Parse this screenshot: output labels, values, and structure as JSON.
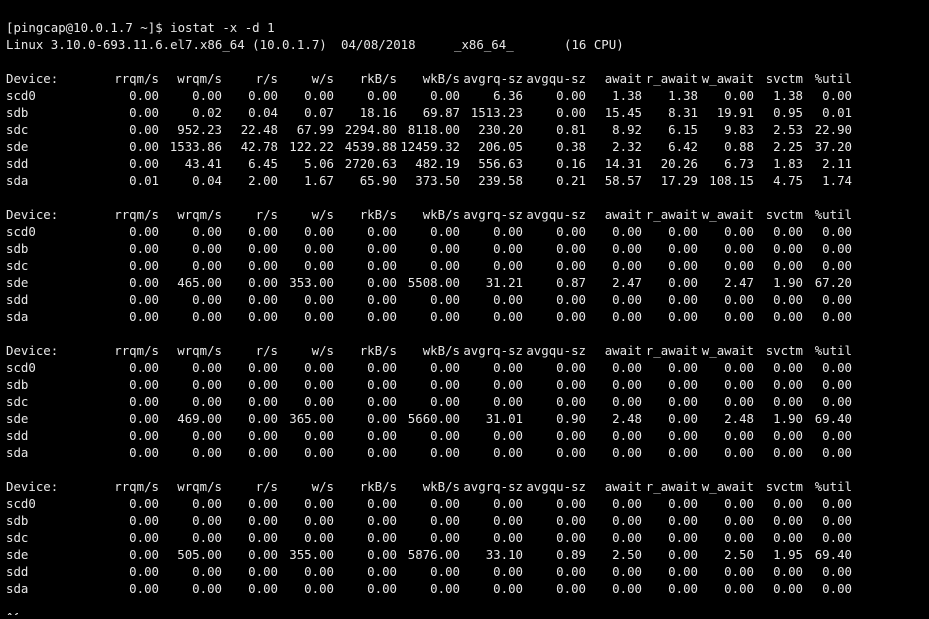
{
  "prompt": "[pingcap@10.0.1.7 ~]$ iostat -x -d 1",
  "system_info": {
    "kernel": "Linux 3.10.0-693.11.6.el7.x86_64 (10.0.1.7)",
    "date": "04/08/2018",
    "arch": "_x86_64_",
    "cpus": "(16 CPU)"
  },
  "columns": [
    "Device:",
    "rrqm/s",
    "wrqm/s",
    "r/s",
    "w/s",
    "rkB/s",
    "wkB/s",
    "avgrq-sz",
    "avgqu-sz",
    "await",
    "r_await",
    "w_await",
    "svctm",
    "%util"
  ],
  "reports": [
    {
      "rows": [
        [
          "scd0",
          "0.00",
          "0.00",
          "0.00",
          "0.00",
          "0.00",
          "0.00",
          "6.36",
          "0.00",
          "1.38",
          "1.38",
          "0.00",
          "1.38",
          "0.00"
        ],
        [
          "sdb",
          "0.00",
          "0.02",
          "0.04",
          "0.07",
          "18.16",
          "69.87",
          "1513.23",
          "0.00",
          "15.45",
          "8.31",
          "19.91",
          "0.95",
          "0.01"
        ],
        [
          "sdc",
          "0.00",
          "952.23",
          "22.48",
          "67.99",
          "2294.80",
          "8118.00",
          "230.20",
          "0.81",
          "8.92",
          "6.15",
          "9.83",
          "2.53",
          "22.90"
        ],
        [
          "sde",
          "0.00",
          "1533.86",
          "42.78",
          "122.22",
          "4539.88",
          "12459.32",
          "206.05",
          "0.38",
          "2.32",
          "6.42",
          "0.88",
          "2.25",
          "37.20"
        ],
        [
          "sdd",
          "0.00",
          "43.41",
          "6.45",
          "5.06",
          "2720.63",
          "482.19",
          "556.63",
          "0.16",
          "14.31",
          "20.26",
          "6.73",
          "1.83",
          "2.11"
        ],
        [
          "sda",
          "0.01",
          "0.04",
          "2.00",
          "1.67",
          "65.90",
          "373.50",
          "239.58",
          "0.21",
          "58.57",
          "17.29",
          "108.15",
          "4.75",
          "1.74"
        ]
      ]
    },
    {
      "rows": [
        [
          "scd0",
          "0.00",
          "0.00",
          "0.00",
          "0.00",
          "0.00",
          "0.00",
          "0.00",
          "0.00",
          "0.00",
          "0.00",
          "0.00",
          "0.00",
          "0.00"
        ],
        [
          "sdb",
          "0.00",
          "0.00",
          "0.00",
          "0.00",
          "0.00",
          "0.00",
          "0.00",
          "0.00",
          "0.00",
          "0.00",
          "0.00",
          "0.00",
          "0.00"
        ],
        [
          "sdc",
          "0.00",
          "0.00",
          "0.00",
          "0.00",
          "0.00",
          "0.00",
          "0.00",
          "0.00",
          "0.00",
          "0.00",
          "0.00",
          "0.00",
          "0.00"
        ],
        [
          "sde",
          "0.00",
          "465.00",
          "0.00",
          "353.00",
          "0.00",
          "5508.00",
          "31.21",
          "0.87",
          "2.47",
          "0.00",
          "2.47",
          "1.90",
          "67.20"
        ],
        [
          "sdd",
          "0.00",
          "0.00",
          "0.00",
          "0.00",
          "0.00",
          "0.00",
          "0.00",
          "0.00",
          "0.00",
          "0.00",
          "0.00",
          "0.00",
          "0.00"
        ],
        [
          "sda",
          "0.00",
          "0.00",
          "0.00",
          "0.00",
          "0.00",
          "0.00",
          "0.00",
          "0.00",
          "0.00",
          "0.00",
          "0.00",
          "0.00",
          "0.00"
        ]
      ]
    },
    {
      "rows": [
        [
          "scd0",
          "0.00",
          "0.00",
          "0.00",
          "0.00",
          "0.00",
          "0.00",
          "0.00",
          "0.00",
          "0.00",
          "0.00",
          "0.00",
          "0.00",
          "0.00"
        ],
        [
          "sdb",
          "0.00",
          "0.00",
          "0.00",
          "0.00",
          "0.00",
          "0.00",
          "0.00",
          "0.00",
          "0.00",
          "0.00",
          "0.00",
          "0.00",
          "0.00"
        ],
        [
          "sdc",
          "0.00",
          "0.00",
          "0.00",
          "0.00",
          "0.00",
          "0.00",
          "0.00",
          "0.00",
          "0.00",
          "0.00",
          "0.00",
          "0.00",
          "0.00"
        ],
        [
          "sde",
          "0.00",
          "469.00",
          "0.00",
          "365.00",
          "0.00",
          "5660.00",
          "31.01",
          "0.90",
          "2.48",
          "0.00",
          "2.48",
          "1.90",
          "69.40"
        ],
        [
          "sdd",
          "0.00",
          "0.00",
          "0.00",
          "0.00",
          "0.00",
          "0.00",
          "0.00",
          "0.00",
          "0.00",
          "0.00",
          "0.00",
          "0.00",
          "0.00"
        ],
        [
          "sda",
          "0.00",
          "0.00",
          "0.00",
          "0.00",
          "0.00",
          "0.00",
          "0.00",
          "0.00",
          "0.00",
          "0.00",
          "0.00",
          "0.00",
          "0.00"
        ]
      ]
    },
    {
      "rows": [
        [
          "scd0",
          "0.00",
          "0.00",
          "0.00",
          "0.00",
          "0.00",
          "0.00",
          "0.00",
          "0.00",
          "0.00",
          "0.00",
          "0.00",
          "0.00",
          "0.00"
        ],
        [
          "sdb",
          "0.00",
          "0.00",
          "0.00",
          "0.00",
          "0.00",
          "0.00",
          "0.00",
          "0.00",
          "0.00",
          "0.00",
          "0.00",
          "0.00",
          "0.00"
        ],
        [
          "sdc",
          "0.00",
          "0.00",
          "0.00",
          "0.00",
          "0.00",
          "0.00",
          "0.00",
          "0.00",
          "0.00",
          "0.00",
          "0.00",
          "0.00",
          "0.00"
        ],
        [
          "sde",
          "0.00",
          "505.00",
          "0.00",
          "355.00",
          "0.00",
          "5876.00",
          "33.10",
          "0.89",
          "2.50",
          "0.00",
          "2.50",
          "1.95",
          "69.40"
        ],
        [
          "sdd",
          "0.00",
          "0.00",
          "0.00",
          "0.00",
          "0.00",
          "0.00",
          "0.00",
          "0.00",
          "0.00",
          "0.00",
          "0.00",
          "0.00",
          "0.00"
        ],
        [
          "sda",
          "0.00",
          "0.00",
          "0.00",
          "0.00",
          "0.00",
          "0.00",
          "0.00",
          "0.00",
          "0.00",
          "0.00",
          "0.00",
          "0.00",
          "0.00"
        ]
      ]
    }
  ],
  "trailing_output": "^C",
  "colors": {
    "background": "#000000",
    "foreground": "#e8e8e8"
  }
}
